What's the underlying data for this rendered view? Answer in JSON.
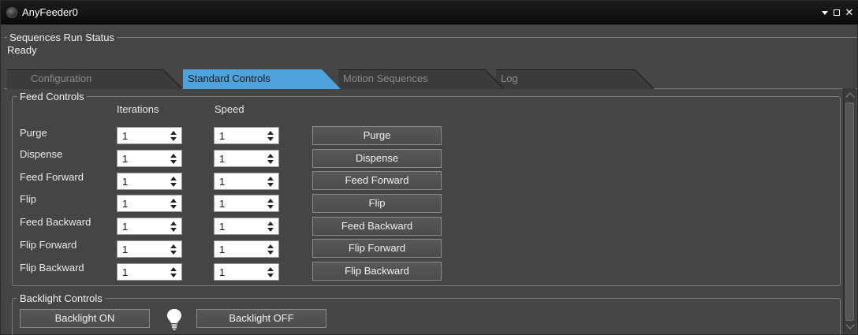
{
  "window": {
    "title": "AnyFeeder0",
    "icon": "app-icon",
    "controls": {
      "pin": "dropdown-pin-icon",
      "maximize": "maximize-icon",
      "close": "close-icon"
    },
    "close_label": "✕"
  },
  "sequences": {
    "group_title": "Sequences Run Status",
    "status": "Ready"
  },
  "tabs": [
    {
      "label": "Configuration",
      "selected": false
    },
    {
      "label": "Standard Controls",
      "selected": true
    },
    {
      "label": "Motion Sequences",
      "selected": false
    },
    {
      "label": "Log",
      "selected": false
    }
  ],
  "feed": {
    "group_title": "Feed Controls",
    "iterations_header": "Iterations",
    "speed_header": "Speed",
    "rows": [
      {
        "label": "Purge",
        "iterations": "1",
        "speed": "1",
        "button": "Purge"
      },
      {
        "label": "Dispense",
        "iterations": "1",
        "speed": "1",
        "button": "Dispense"
      },
      {
        "label": "Feed Forward",
        "iterations": "1",
        "speed": "1",
        "button": "Feed Forward"
      },
      {
        "label": "Flip",
        "iterations": "1",
        "speed": "1",
        "button": "Flip"
      },
      {
        "label": "Feed Backward",
        "iterations": "1",
        "speed": "1",
        "button": "Feed Backward"
      },
      {
        "label": "Flip Forward",
        "iterations": "1",
        "speed": "1",
        "button": "Flip Forward"
      },
      {
        "label": "Flip Backward",
        "iterations": "1",
        "speed": "1",
        "button": "Flip Backward"
      }
    ]
  },
  "backlight": {
    "group_title": "Backlight Controls",
    "on_label": "Backlight ON",
    "off_label": "Backlight OFF",
    "icon": "lightbulb-icon"
  },
  "colors": {
    "selected_tab": "#4fa3dc",
    "background": "#454545",
    "titlebar": "#0c0c0c"
  }
}
